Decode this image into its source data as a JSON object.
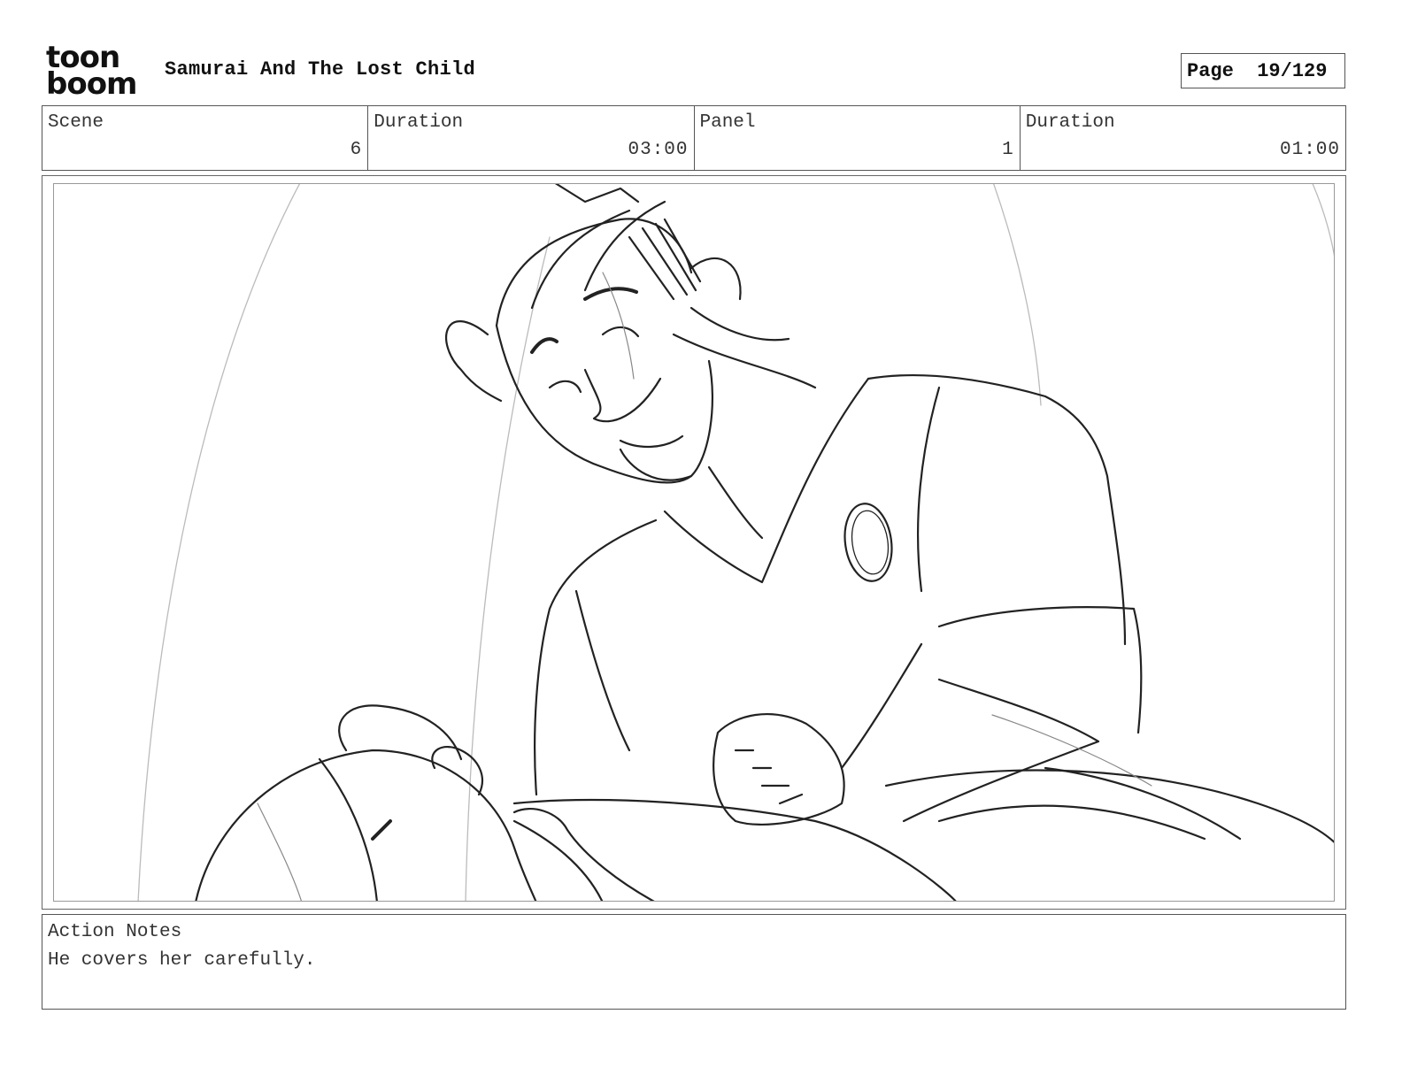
{
  "header": {
    "logo_line1": "toon",
    "logo_line2": "boom",
    "project_title": "Samurai And The Lost Child",
    "page_label": "Page  19/129"
  },
  "info": {
    "scene_label": "Scene",
    "scene_value": "6",
    "scene_duration_label": "Duration",
    "scene_duration_value": "03:00",
    "panel_label": "Panel",
    "panel_value": "1",
    "panel_duration_label": "Duration",
    "panel_duration_value": "01:00"
  },
  "notes": {
    "label": "Action Notes",
    "text": "He covers her carefully."
  }
}
